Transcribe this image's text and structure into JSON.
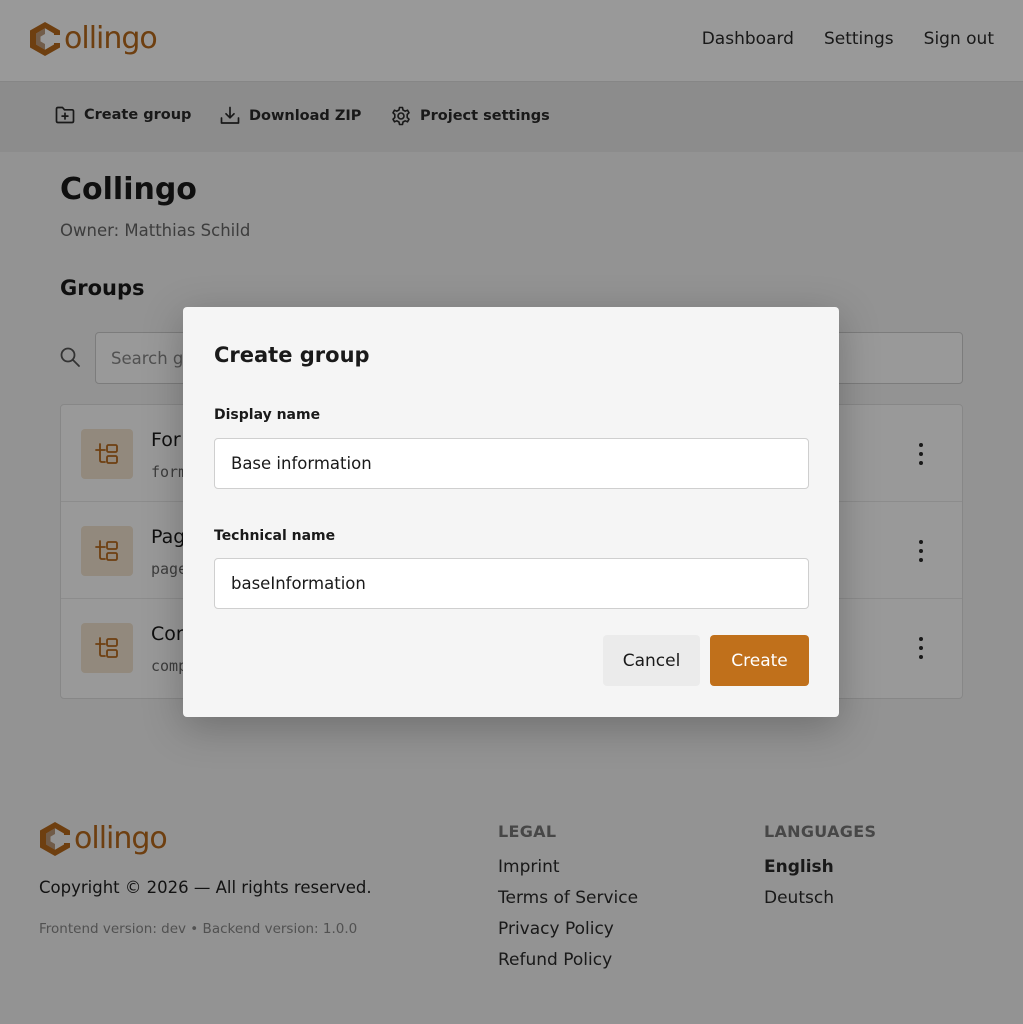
{
  "app": {
    "logo_text": "ollingo",
    "brand_color": "#b8691b"
  },
  "topnav": {
    "dashboard": "Dashboard",
    "settings": "Settings",
    "sign_out": "Sign out"
  },
  "toolbar": {
    "create_group": "Create group",
    "download_zip": "Download ZIP",
    "project_settings": "Project settings"
  },
  "project": {
    "title": "Collingo",
    "owner": "Owner: Matthias Schild"
  },
  "groups": {
    "title": "Groups",
    "search_placeholder": "Search g",
    "items": [
      {
        "name": "For",
        "technical": "form"
      },
      {
        "name": "Pag",
        "technical": "page"
      },
      {
        "name": "Cor",
        "technical": "comp"
      }
    ]
  },
  "modal": {
    "title": "Create group",
    "display_name_label": "Display name",
    "display_name_value": "Base information",
    "technical_name_label": "Technical name",
    "technical_name_value": "baseInformation",
    "cancel_label": "Cancel",
    "create_label": "Create",
    "accent_color": "#c0701b"
  },
  "footer": {
    "logo_text": "ollingo",
    "copyright": "Copyright © 2026 — All rights reserved.",
    "versions": "Frontend version: dev  •  Backend version: 1.0.0",
    "legal": {
      "heading": "LEGAL",
      "links": [
        "Imprint",
        "Terms of Service",
        "Privacy Policy",
        "Refund Policy"
      ]
    },
    "languages": {
      "heading": "LANGUAGES",
      "links": [
        "English",
        "Deutsch"
      ],
      "active": "English"
    }
  }
}
